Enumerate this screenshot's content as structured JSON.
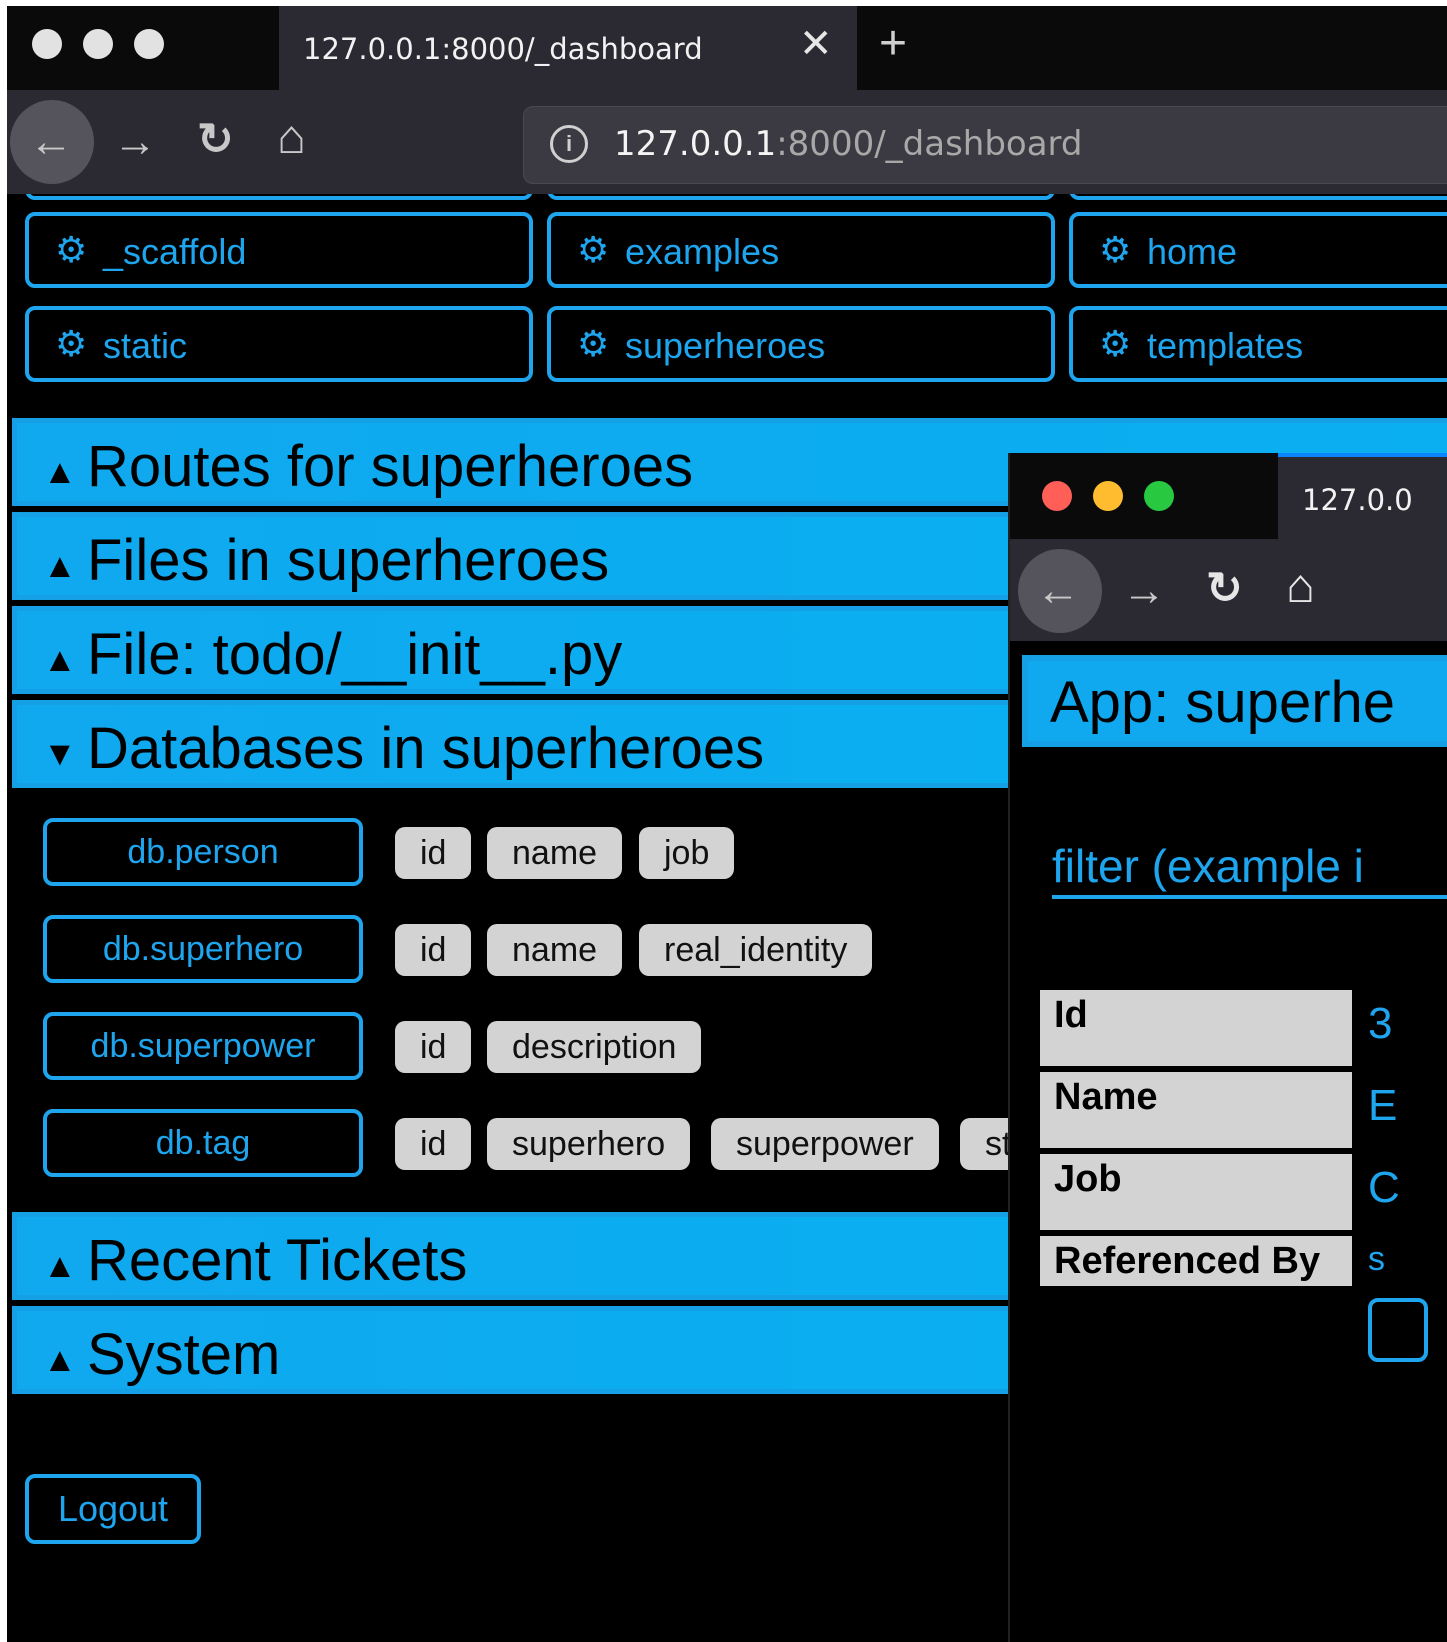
{
  "browser": {
    "tab_title": "127.0.0.1:8000/_dashboard",
    "close_glyph": "✕",
    "newtab_glyph": "+",
    "url_host": "127.0.0.1",
    "url_path": ":8000/_dashboard",
    "back_glyph": "←",
    "forward_glyph": "→",
    "reload_glyph": "↻",
    "home_glyph": "⌂"
  },
  "apps": [
    {
      "label": "_scaffold"
    },
    {
      "label": "examples"
    },
    {
      "label": "home"
    },
    {
      "label": "static"
    },
    {
      "label": "superheroes"
    },
    {
      "label": "templates"
    }
  ],
  "sections": {
    "routes": {
      "arrow": "▲",
      "title": "Routes for superheroes"
    },
    "files": {
      "arrow": "▲",
      "title": "Files in superheroes"
    },
    "file": {
      "arrow": "▲",
      "title": "File: todo/__init__.py"
    },
    "databases": {
      "arrow": "▼",
      "title": "Databases in superheroes"
    },
    "tickets": {
      "arrow": "▲",
      "title": "Recent Tickets"
    },
    "system": {
      "arrow": "▲",
      "title": "System"
    }
  },
  "tables": [
    {
      "name": "db.person",
      "fields": [
        "id",
        "name",
        "job"
      ]
    },
    {
      "name": "db.superhero",
      "fields": [
        "id",
        "name",
        "real_identity"
      ]
    },
    {
      "name": "db.superpower",
      "fields": [
        "id",
        "description"
      ]
    },
    {
      "name": "db.tag",
      "fields": [
        "id",
        "superhero",
        "superpower",
        "st"
      ]
    }
  ],
  "logout_label": "Logout",
  "second_window": {
    "tab_title": "127.0.0",
    "app_header": "App: superhe",
    "filter_text": "filter (example i",
    "rows": [
      {
        "label": "Id",
        "value_cut": "3"
      },
      {
        "label": "Name",
        "value_cut": "E"
      },
      {
        "label": "Job",
        "value_cut": "C"
      },
      {
        "label": "Referenced By",
        "value_cut": "s"
      }
    ]
  },
  "colors": {
    "accent": "#1ea5ee",
    "section_bg": "#10a8ef",
    "field_bg": "#d3d3d3",
    "chrome": "#2b2a33"
  }
}
